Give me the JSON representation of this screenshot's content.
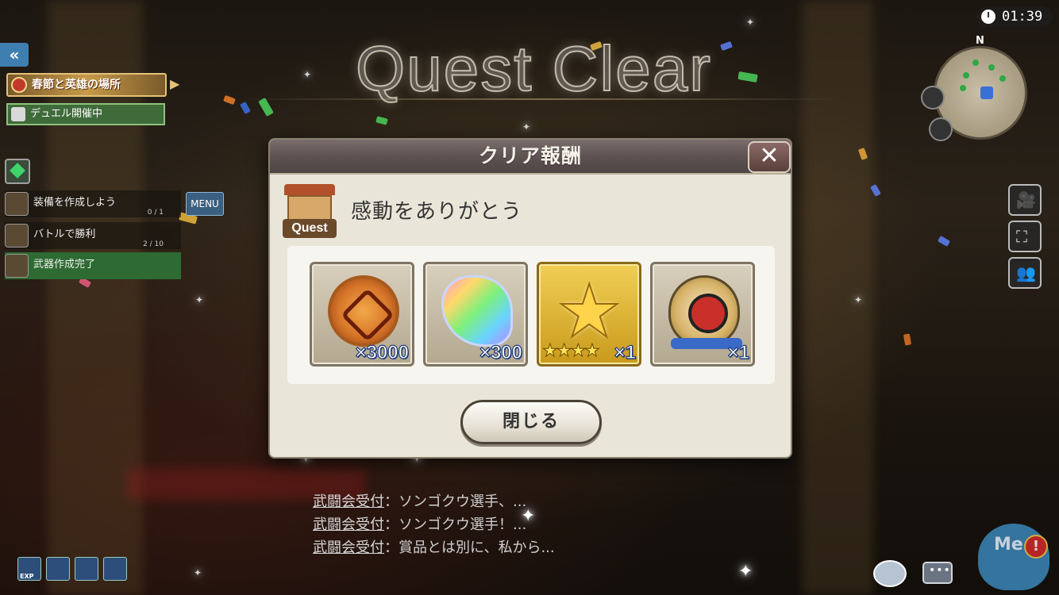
{
  "banner": {
    "title": "Quest Clear"
  },
  "hud": {
    "timer": "01:39",
    "compass": "N",
    "event_banner": "春節と英雄の場所",
    "duel_banner": "デュエル開催中",
    "menu_label": "MENU",
    "missions": [
      {
        "label": "装備を作成しよう",
        "count": "0 / 1"
      },
      {
        "label": "バトルで勝利",
        "count": "2 / 10"
      },
      {
        "label": "武器作成完了",
        "count": ""
      }
    ],
    "bottom_icons": [
      {
        "label": "EXP"
      },
      {
        "label": ""
      },
      {
        "label": ""
      },
      {
        "label": ""
      }
    ],
    "me_label": "Me",
    "alert_symbol": "!"
  },
  "modal": {
    "title": "クリア報酬",
    "close_symbol": "✕",
    "quest_icon_label": "Quest",
    "quest_name": "感動をありがとう",
    "rewards": [
      {
        "icon": "medal-icon",
        "quantity": "×3000",
        "stars": ""
      },
      {
        "icon": "rainbow-ore-icon",
        "quantity": "×300",
        "stars": ""
      },
      {
        "icon": "star-crystal-icon",
        "quantity": "×1",
        "stars": "★★★★"
      },
      {
        "icon": "fortune-badge-icon",
        "quantity": "×1",
        "stars": ""
      }
    ],
    "close_button": "閉じる"
  },
  "chat": [
    {
      "speaker": "武闘会受付",
      "message": "：ソンゴクウ選手、..."
    },
    {
      "speaker": "武闘会受付",
      "message": "：ソンゴクウ選手！..."
    },
    {
      "speaker": "武闘会受付",
      "message": "：賞品とは別に、私から..."
    }
  ],
  "colors": {
    "accent_gold": "#c99a1c",
    "modal_bg": "#e9e5d9",
    "header": "#5e5352"
  }
}
